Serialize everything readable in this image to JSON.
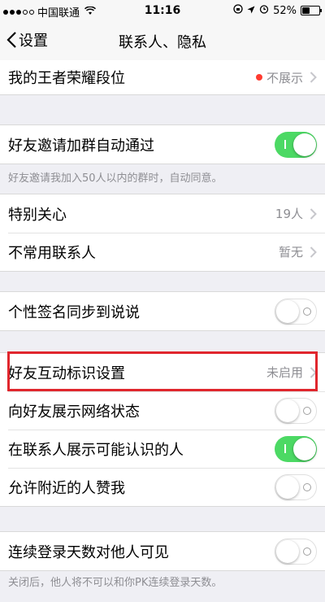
{
  "status_bar": {
    "carrier": "中国联通",
    "time": "11:16",
    "battery": "52%",
    "battery_level": 0.52
  },
  "nav": {
    "back_label": "设置",
    "title": "联系人、隐私"
  },
  "rows": {
    "rank": {
      "label": "我的王者荣耀段位",
      "value": "不展示"
    },
    "group_invite": {
      "label": "好友邀请加群自动通过",
      "toggle": true
    },
    "group_invite_note": "好友邀请我加入50人以内的群时，自动同意。",
    "special_care": {
      "label": "特别关心",
      "value": "19人"
    },
    "infrequent": {
      "label": "不常用联系人",
      "value": "暂无"
    },
    "signature_sync": {
      "label": "个性签名同步到说说",
      "toggle": false
    },
    "interaction_badge": {
      "label": "好友互动标识设置",
      "value": "未启用"
    },
    "network_status": {
      "label": "向好友展示网络状态",
      "toggle": false
    },
    "may_know": {
      "label": "在联系人展示可能认识的人",
      "toggle": true
    },
    "nearby_like": {
      "label": "允许附近的人赞我",
      "toggle": false
    },
    "login_days": {
      "label": "连续登录天数对他人可见",
      "toggle": false
    },
    "login_days_note": "关闭后，他人将不可以和你PK连续登录天数。"
  },
  "icons": {
    "back": "chevron-left-icon",
    "chevron": "chevron-right-icon",
    "wifi": "wifi-icon",
    "lock_rotation": "rotation-lock-icon",
    "location": "location-arrow-icon",
    "alarm": "alarm-icon"
  },
  "colors": {
    "toggle_on": "#4cd964",
    "highlight": "#e0262d",
    "badge_dot": "#ff3b30"
  }
}
